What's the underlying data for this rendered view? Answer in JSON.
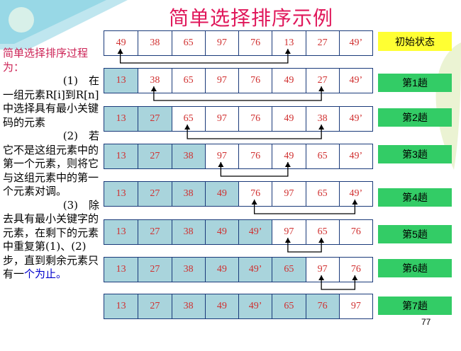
{
  "title": "简单选择排序示例",
  "description": {
    "heading": "简单选择排序过程为：",
    "step1_num": "(1)　在",
    "step1_text": "一组元素R[i]到R[n]中选择具有最小关键码的元素",
    "step2_num": "(2)　若",
    "step2_text": "它不是这组元素中的第一个元素，则将它与这组元素中的第一个元素对调。",
    "step3_num": "(3)　除",
    "step3_text": "去具有最小关键字的元素，在剩下的元素中重复第(1)、(2)步，直到剩余元素只有一",
    "step3_highlight": "个为止。"
  },
  "rows": [
    {
      "label": "初始状态",
      "values": [
        "49",
        "38",
        "65",
        "97",
        "76",
        "13",
        "27",
        "49’"
      ],
      "sorted": 0,
      "swap": [
        0,
        5
      ]
    },
    {
      "label": "第1趟",
      "values": [
        "13",
        "38",
        "65",
        "97",
        "76",
        "49",
        "27",
        "49’"
      ],
      "sorted": 1,
      "swap": [
        1,
        6
      ]
    },
    {
      "label": "第2趟",
      "values": [
        "13",
        "27",
        "65",
        "97",
        "76",
        "49",
        "38",
        "49’"
      ],
      "sorted": 2,
      "swap": [
        2,
        6
      ]
    },
    {
      "label": "第3趟",
      "values": [
        "13",
        "27",
        "38",
        "97",
        "76",
        "49",
        "65",
        "49’"
      ],
      "sorted": 3,
      "swap": [
        3,
        5
      ]
    },
    {
      "label": "第4趟",
      "values": [
        "13",
        "27",
        "38",
        "49",
        "76",
        "97",
        "65",
        "49’"
      ],
      "sorted": 4,
      "swap": [
        4,
        7
      ]
    },
    {
      "label": "第5趟",
      "values": [
        "13",
        "27",
        "38",
        "49",
        "49’",
        "97",
        "65",
        "76"
      ],
      "sorted": 5,
      "swap": [
        5,
        6
      ]
    },
    {
      "label": "第6趟",
      "values": [
        "13",
        "27",
        "38",
        "49",
        "49’",
        "65",
        "97",
        "76"
      ],
      "sorted": 6,
      "swap": [
        6,
        7
      ]
    },
    {
      "label": "第7趟",
      "values": [
        "13",
        "27",
        "38",
        "49",
        "49’",
        "65",
        "76",
        "97"
      ],
      "sorted": 7,
      "swap": null
    }
  ],
  "page_number": "77",
  "colors": {
    "title": "#e0185b",
    "cell_text": "#d03030",
    "sorted_bg": "#a9d4dc",
    "label_bg": "#33cc66",
    "init_label_bg": "#ffff33"
  }
}
